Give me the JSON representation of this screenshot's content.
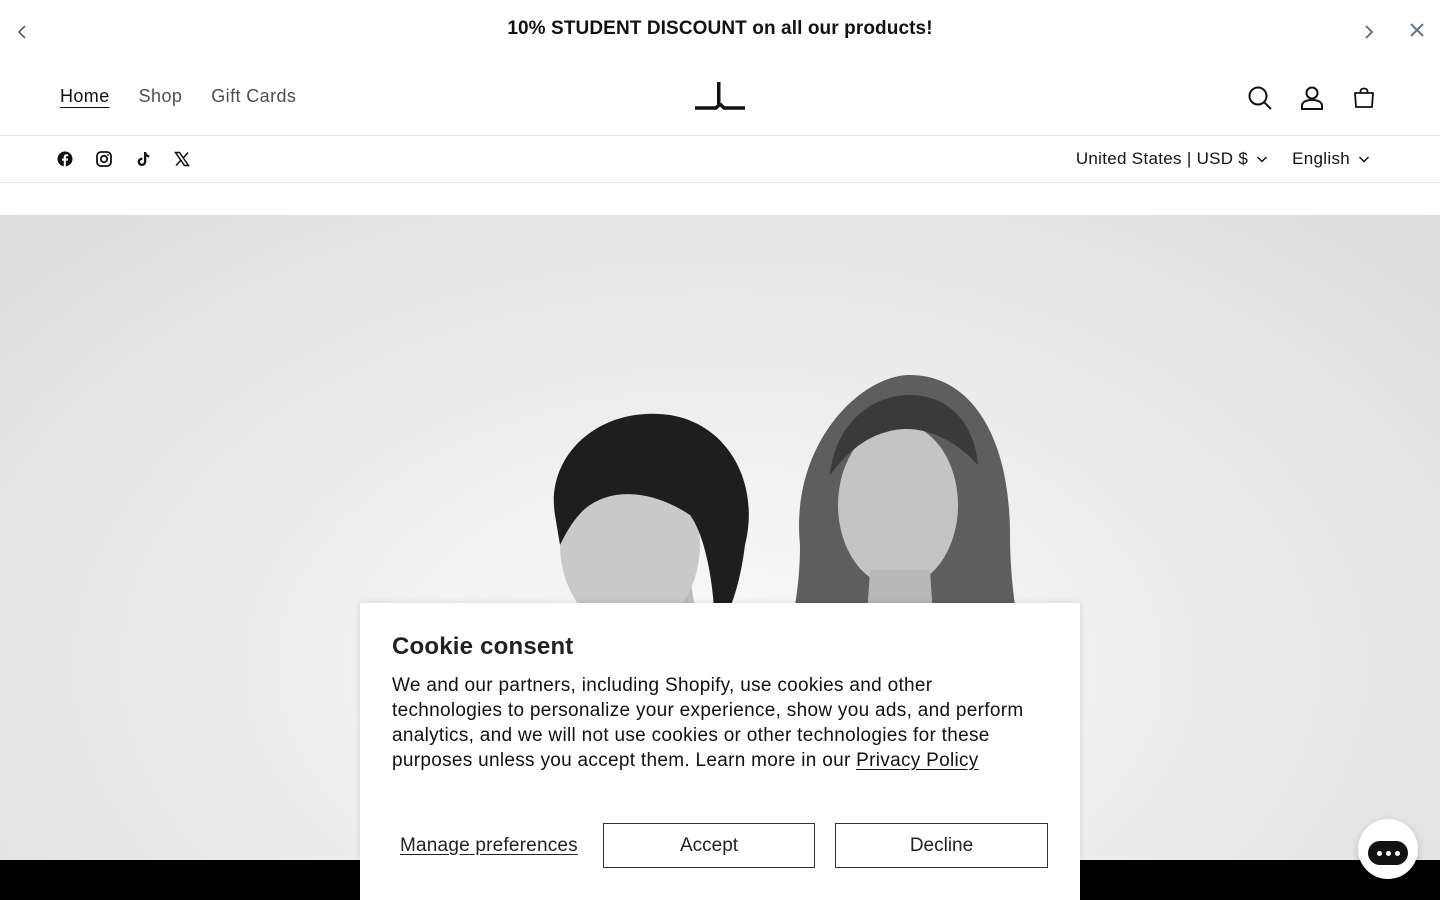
{
  "announcement": {
    "text": "10% STUDENT DISCOUNT on all our products!"
  },
  "nav": {
    "items": [
      {
        "label": "Home",
        "active": true
      },
      {
        "label": "Shop",
        "active": false
      },
      {
        "label": "Gift Cards",
        "active": false
      }
    ]
  },
  "header_icons": [
    "search-icon",
    "account-icon",
    "cart-icon"
  ],
  "socials": [
    "facebook-icon",
    "instagram-icon",
    "tiktok-icon",
    "x-icon"
  ],
  "locale": {
    "country": "United States | USD $",
    "language": "English"
  },
  "cookie": {
    "title": "Cookie consent",
    "body": "We and our partners, including Shopify, use cookies and other technologies to personalize your experience, show you ads, and perform analytics, and we will not use cookies or other technologies for these purposes unless you accept them. Learn more in our ",
    "link": "Privacy Policy",
    "manage": "Manage preferences",
    "accept": "Accept",
    "decline": "Decline"
  },
  "colors": {
    "text": "#121212",
    "footer": "#000000"
  }
}
